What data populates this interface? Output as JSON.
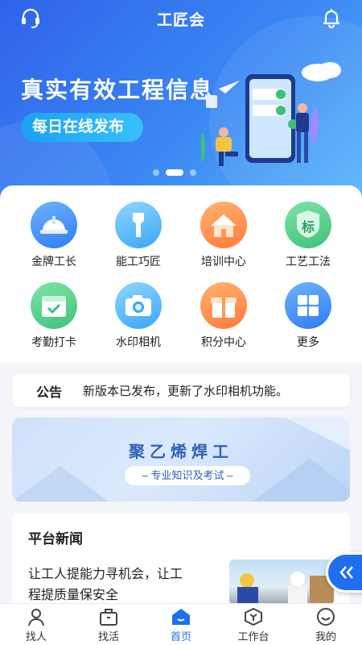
{
  "header": {
    "title": "工匠会",
    "support_icon": "headset-icon",
    "notification_icon": "bell-icon"
  },
  "banner": {
    "headline": "真实有效工程信息",
    "subline": "每日在线发布",
    "slide_count": 3,
    "active_slide": 2
  },
  "features": [
    {
      "label": "金牌工长",
      "icon": "helmet-icon",
      "color": "#2f7bf0"
    },
    {
      "label": "能工巧匠",
      "icon": "wrench-icon",
      "color": "#3aa7f5"
    },
    {
      "label": "培训中心",
      "icon": "house-icon",
      "color": "#ff8b3d"
    },
    {
      "label": "工艺工法",
      "icon": "shield-badge-icon",
      "color": "#3ec27a",
      "badge": "标"
    },
    {
      "label": "考勤打卡",
      "icon": "calendar-check-icon",
      "color": "#3ec27a"
    },
    {
      "label": "水印相机",
      "icon": "camera-icon",
      "color": "#3aa7f5"
    },
    {
      "label": "积分中心",
      "icon": "gift-icon",
      "color": "#ff7a3d"
    },
    {
      "label": "更多",
      "icon": "grid-icon",
      "color": "#2f7bf0"
    }
  ],
  "notice": {
    "tag": "公告",
    "text": "新版本已发布，更新了水印相机功能。"
  },
  "course": {
    "title": "聚乙烯焊工",
    "subtitle": "专业知识及考试"
  },
  "news": {
    "title": "平台新闻",
    "lines": [
      "让工人提能力寻机会，让工",
      "程提质量保安全"
    ]
  },
  "tabbar": {
    "items": [
      {
        "label": "找人",
        "icon": "person-icon"
      },
      {
        "label": "找活",
        "icon": "briefcase-icon"
      },
      {
        "label": "首页",
        "icon": "home-icon",
        "active": true
      },
      {
        "label": "工作台",
        "icon": "workbench-icon"
      },
      {
        "label": "我的",
        "icon": "smile-icon"
      }
    ]
  },
  "colors": {
    "primary": "#1e6ff0",
    "banner_start": "#2f63ea",
    "banner_end": "#56b4fb"
  }
}
